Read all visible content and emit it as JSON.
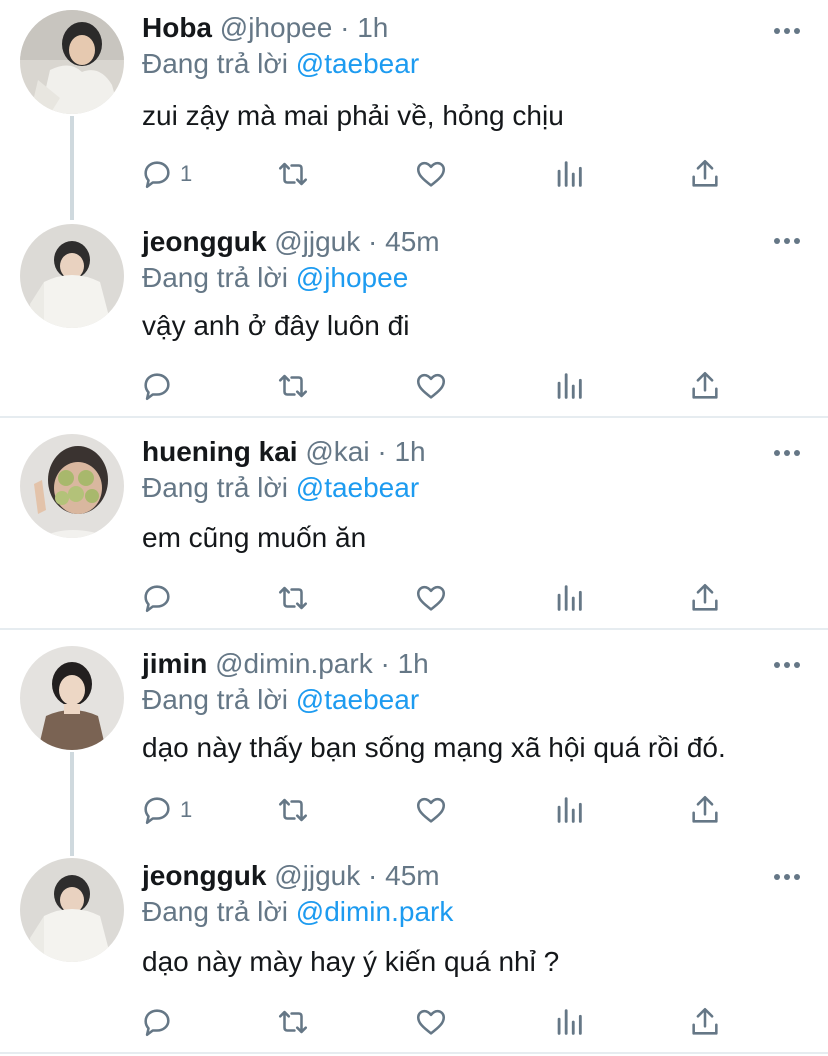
{
  "reply_prefix": "Đang trả lời",
  "tweets": [
    {
      "name": "Hoba",
      "handle": "@jhopee",
      "time": "1h",
      "reply_to": "@taebear",
      "text": "zui zậy mà mai phải về, hỏng chịu",
      "reply_count": "1"
    },
    {
      "name": "jeongguk",
      "handle": "@jjguk",
      "time": "45m",
      "reply_to": "@jhopee",
      "text": "vậy anh ở đây luôn đi",
      "reply_count": ""
    },
    {
      "name": "huening kai",
      "handle": "@kai",
      "time": "1h",
      "reply_to": "@taebear",
      "text": "em cũng muốn ăn",
      "reply_count": ""
    },
    {
      "name": "jimin",
      "handle": "@dimin.park",
      "time": "1h",
      "reply_to": "@taebear",
      "text": "dạo này thấy bạn sống mạng xã hội quá rồi đó.",
      "reply_count": "1"
    },
    {
      "name": "jeongguk",
      "handle": "@jjguk",
      "time": "45m",
      "reply_to": "@dimin.park",
      "text": "dạo này mày hay ý kiến quá nhỉ ?",
      "reply_count": ""
    }
  ],
  "separator": "·",
  "colors": {
    "accent": "#1d9bf0",
    "muted": "#657786",
    "text": "#14171a",
    "divider": "#e6ecf0"
  }
}
